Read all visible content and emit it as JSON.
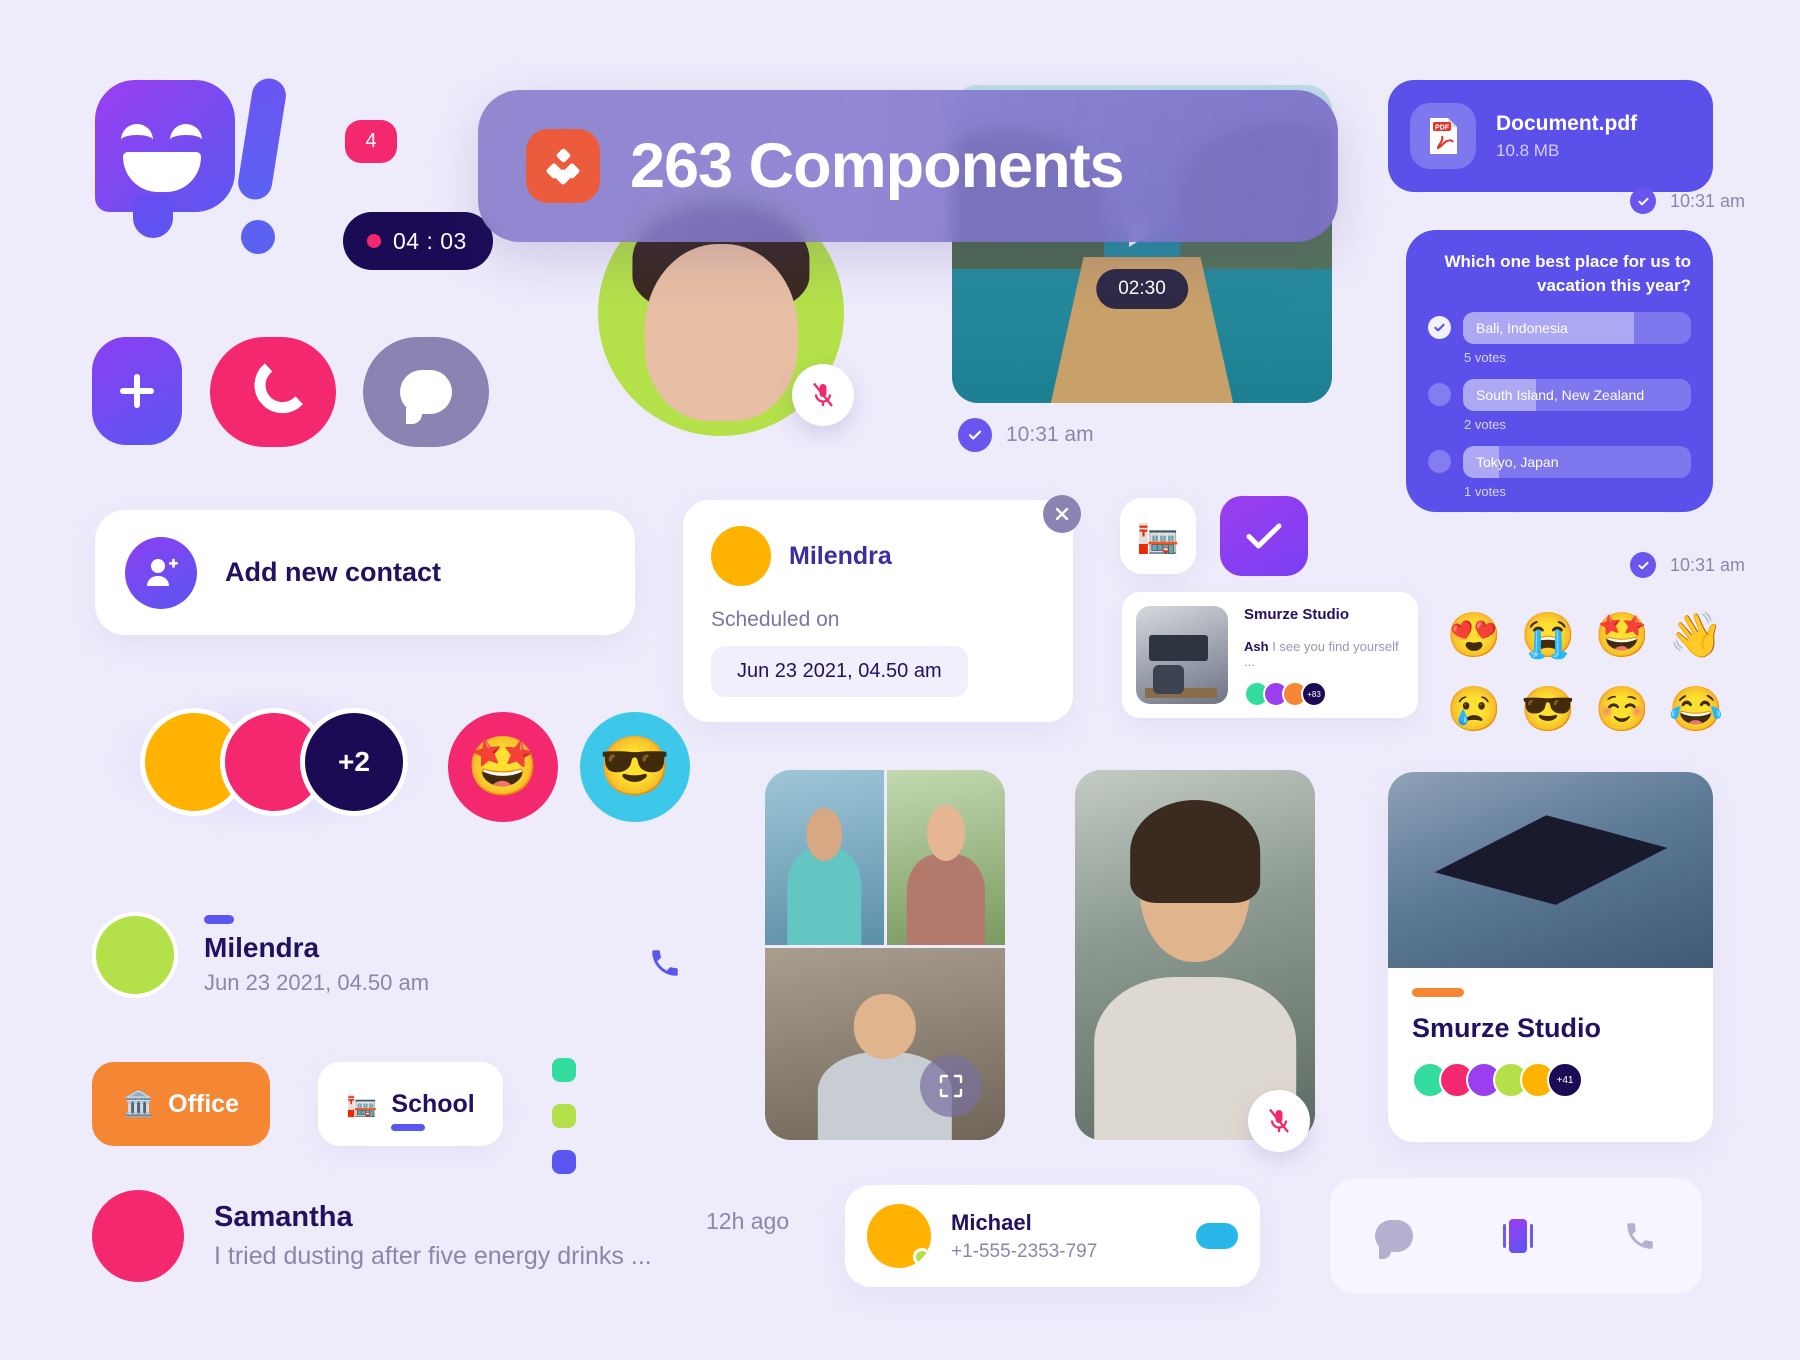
{
  "banner": {
    "title": "263 Components",
    "icon": "cubes-icon"
  },
  "badge": {
    "count": "4"
  },
  "timer": {
    "value": "04 : 03"
  },
  "self_video": {
    "mic_icon": "mic-muted-icon"
  },
  "video_message": {
    "duration": "02:30",
    "timestamp": "10:31 am",
    "play_icon": "play-icon"
  },
  "pdf_card": {
    "name": "Document.pdf",
    "size": "10.8 MB",
    "icon": "pdf-icon",
    "timestamp": "10:31 am"
  },
  "poll": {
    "question": "Which one best place for us to vacation this year?",
    "timestamp": "10:31 am",
    "options": [
      {
        "label": "Bali, Indonesia",
        "votes": "5 votes",
        "percent": 75,
        "selected": true
      },
      {
        "label": "South Island, New Zealand",
        "votes": "2 votes",
        "percent": 32,
        "selected": false
      },
      {
        "label": "Tokyo, Japan",
        "votes": "1 votes",
        "percent": 16,
        "selected": false
      }
    ]
  },
  "add_contact": {
    "label": "Add new contact",
    "icon": "add-user-icon"
  },
  "scheduled": {
    "name": "Milendra",
    "subtitle": "Scheduled on",
    "date": "Jun 23 2021, 04.50 am",
    "close_icon": "close-icon"
  },
  "square_buttons": {
    "school_icon": "post-office-icon",
    "check_icon": "check-icon"
  },
  "studio_message": {
    "name": "Smurze Studio",
    "sender": "Ash",
    "preview": "I see you find yourself ...",
    "more": "+83"
  },
  "emoji_grid": {
    "items": [
      "😍",
      "😭",
      "🤩",
      "👋",
      "😢",
      "😎",
      "☺️",
      "😂"
    ]
  },
  "avatar_group": {
    "extra": "+2"
  },
  "reaction_buttons": {
    "star": "🤩",
    "cool": "😎"
  },
  "contact_milendra": {
    "name": "Milendra",
    "time": "Jun 23 2021, 04.50 am",
    "call_icon": "phone-icon"
  },
  "tags": {
    "office": {
      "label": "Office",
      "icon": "🏛️"
    },
    "school": {
      "label": "School",
      "icon": "🏣"
    },
    "colors": [
      "#35dca0",
      "#b4e04a",
      "#5b56f0"
    ]
  },
  "contact_samantha": {
    "name": "Samantha",
    "message": "I tried dusting after five energy drinks ..."
  },
  "group_video": {
    "expand_icon": "expand-icon"
  },
  "portrait_video": {
    "mic_icon": "mic-muted-icon"
  },
  "story_card": {
    "name": "Smurze Studio",
    "more": "+41"
  },
  "michael_card": {
    "ago": "12h ago",
    "name": "Michael",
    "phone": "+1-555-2353-797",
    "toggle_on": true
  },
  "bottom_nav": {
    "items": [
      "chat-icon",
      "stories-icon",
      "phone-icon"
    ],
    "active_index": 1
  },
  "colors": {
    "background": "#eeecfb",
    "primary": "#5b56f0",
    "accent_pink": "#f3286e",
    "accent_orange": "#f58634",
    "dark": "#1b0b55"
  }
}
